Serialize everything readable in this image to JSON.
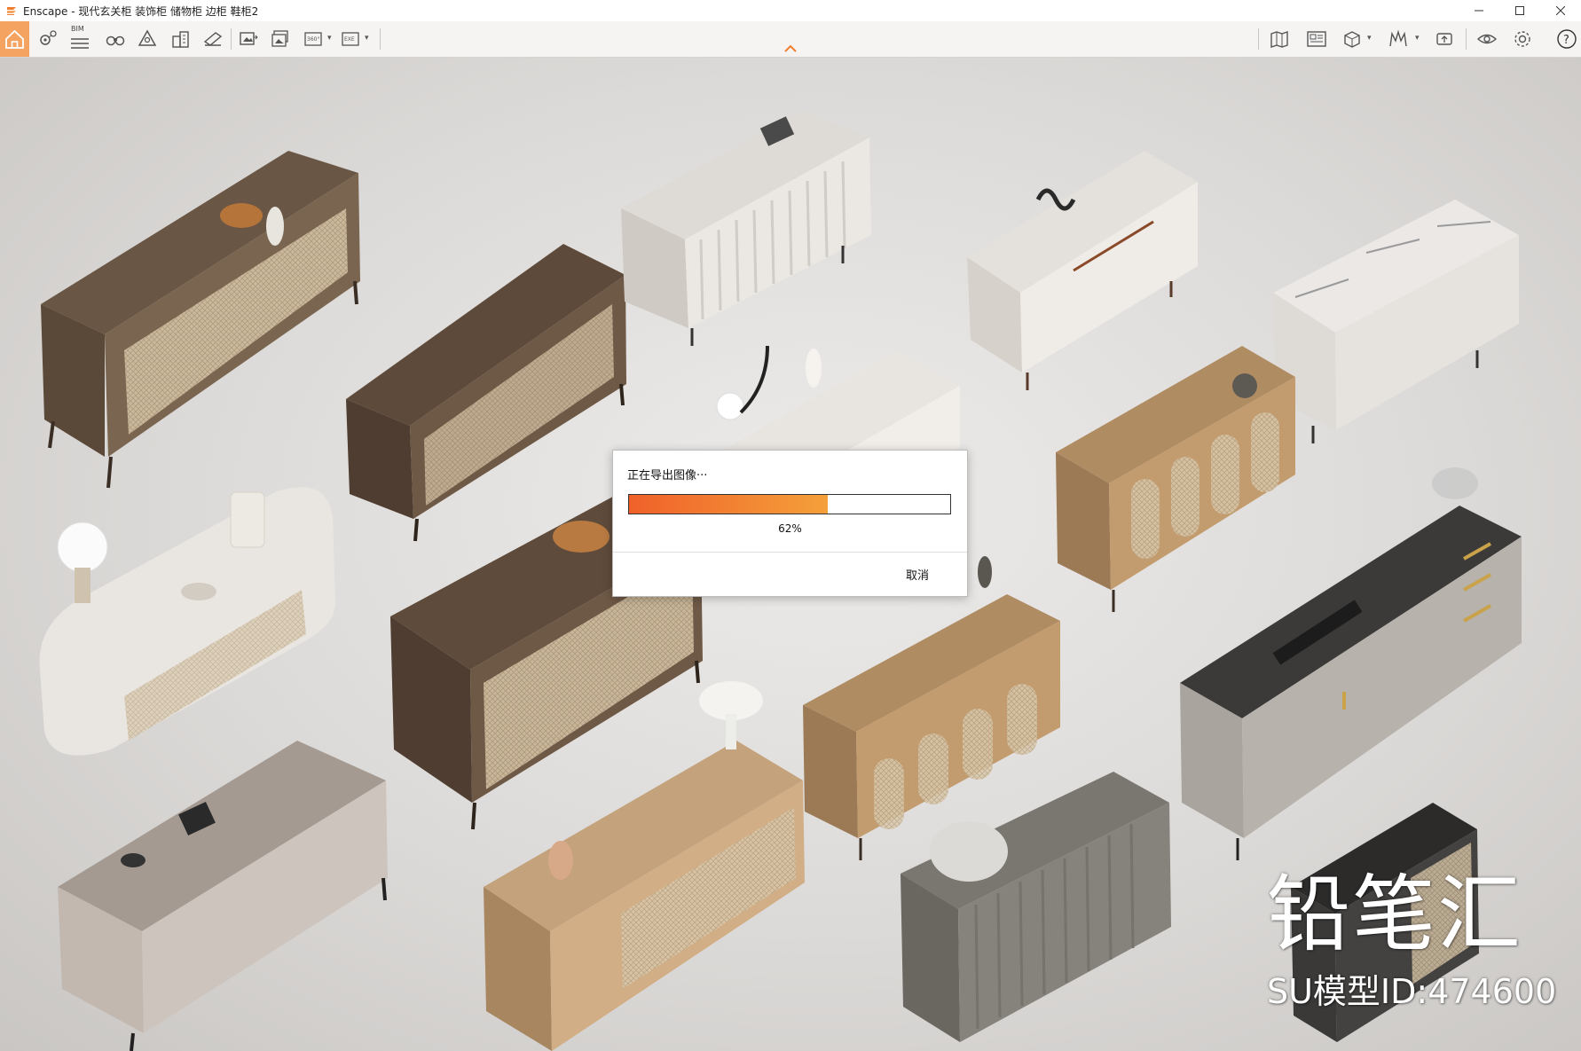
{
  "window": {
    "title": "Enscape - 现代玄关柜 装饰柜 储物柜 边柜 鞋柜2",
    "minimize_icon": "minimize-icon",
    "maximize_icon": "maximize-icon",
    "close_icon": "close-icon"
  },
  "toolbar": {
    "bim_label": "BIM",
    "left_icons": [
      "home-icon",
      "location-icon",
      "bim-icon",
      "binoculars-icon",
      "asset-library-icon",
      "buildings-icon",
      "material-editor-icon",
      "screenshot-icon",
      "batch-render-icon",
      "panorama-360-icon",
      "export-exe-icon"
    ],
    "right_icons": [
      "map-icon",
      "views-icon",
      "cube-icon",
      "sections-icon",
      "upload-icon",
      "visibility-icon",
      "settings-icon",
      "help-icon"
    ],
    "accent_color": "#f4a460"
  },
  "viewport": {
    "watermark_title": "铅笔汇",
    "watermark_sub": "SU模型ID:474600"
  },
  "dialog": {
    "message": "正在导出图像···",
    "progress": 0.62,
    "progress_text": "62%",
    "cancel_label": "取消"
  }
}
